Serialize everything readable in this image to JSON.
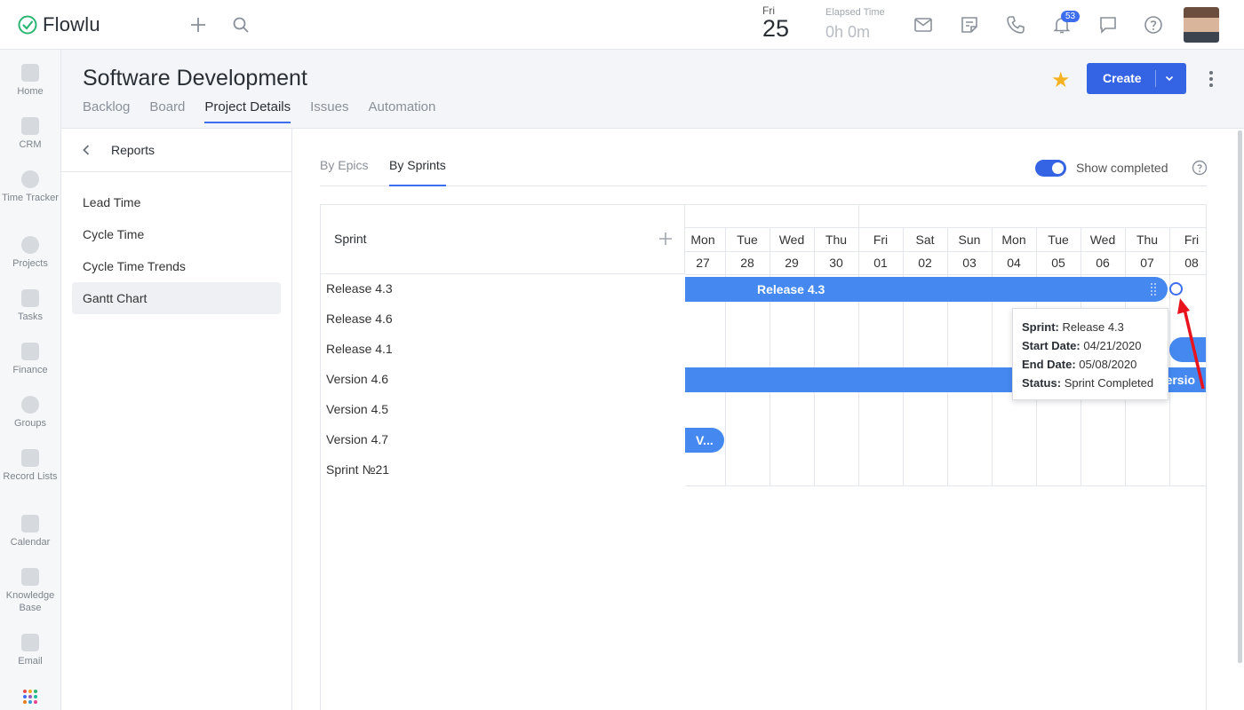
{
  "app": {
    "name": "Flowlu",
    "date_day": "Fri",
    "date_num": "25",
    "elapsed_label": "Elapsed Time",
    "elapsed_value": "0h 0m",
    "notifications_count": "53",
    "accent": "#3463e4"
  },
  "leftnav": [
    {
      "label": "Home",
      "icon": "heart-icon"
    },
    {
      "label": "CRM",
      "icon": "crm-icon"
    },
    {
      "label": "Time Tracker",
      "icon": "timer-icon"
    },
    {
      "label": "Projects",
      "icon": "projects-icon"
    },
    {
      "label": "Tasks",
      "icon": "tasks-icon"
    },
    {
      "label": "Finance",
      "icon": "finance-icon"
    },
    {
      "label": "Groups",
      "icon": "groups-icon"
    },
    {
      "label": "Record Lists",
      "icon": "record-lists-icon"
    },
    {
      "label": "Calendar",
      "icon": "calendar-icon"
    },
    {
      "label": "Knowledge Base",
      "icon": "book-icon"
    },
    {
      "label": "Email",
      "icon": "email-icon"
    }
  ],
  "page": {
    "title": "Software Development",
    "tabs": [
      "Backlog",
      "Board",
      "Project Details",
      "Issues",
      "Automation"
    ],
    "active_tab": "Project Details",
    "create_label": "Create"
  },
  "reports": {
    "title": "Reports",
    "items": [
      "Lead Time",
      "Cycle Time",
      "Cycle Time Trends",
      "Gantt Chart"
    ],
    "active_item": "Gantt Chart"
  },
  "gantt": {
    "subtabs": [
      "By Epics",
      "By Sprints"
    ],
    "active_subtab": "By Sprints",
    "show_completed_label": "Show completed",
    "show_completed": true,
    "column_title": "Sprint",
    "days": [
      {
        "dow": "Mon",
        "num": "27"
      },
      {
        "dow": "Tue",
        "num": "28"
      },
      {
        "dow": "Wed",
        "num": "29"
      },
      {
        "dow": "Thu",
        "num": "30"
      },
      {
        "dow": "Fri",
        "num": "01"
      },
      {
        "dow": "Sat",
        "num": "02"
      },
      {
        "dow": "Sun",
        "num": "03"
      },
      {
        "dow": "Mon",
        "num": "04"
      },
      {
        "dow": "Tue",
        "num": "05"
      },
      {
        "dow": "Wed",
        "num": "06"
      },
      {
        "dow": "Thu",
        "num": "07"
      },
      {
        "dow": "Fri",
        "num": "08"
      }
    ],
    "rows": [
      "Release 4.3",
      "Release 4.6",
      "Release 4.1",
      "Version 4.6",
      "Version 4.5",
      "Version 4.7",
      "Sprint №21"
    ],
    "bars": {
      "release43": "Release 4.3",
      "version46": "Versio",
      "version47": "V..."
    },
    "tooltip": {
      "sprint_label": "Sprint:",
      "sprint_value": "Release 4.3",
      "start_label": "Start Date:",
      "start_value": "04/21/2020",
      "end_label": "End Date:",
      "end_value": "05/08/2020",
      "status_label": "Status:",
      "status_value": "Sprint Completed"
    }
  }
}
